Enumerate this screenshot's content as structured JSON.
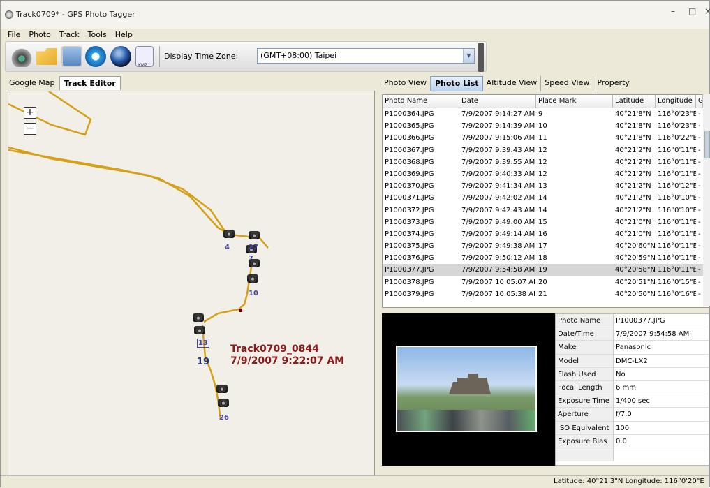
{
  "window": {
    "title": "Track0709* - GPS Photo Tagger"
  },
  "menu": [
    {
      "u": "F",
      "rest": "ile"
    },
    {
      "u": "P",
      "rest": "hoto"
    },
    {
      "u": "T",
      "rest": "rack"
    },
    {
      "u": "T",
      "rest": "ools"
    },
    {
      "u": "H",
      "rest": "elp"
    }
  ],
  "toolbar": {
    "kmz_label": "KMZ",
    "timezone_label": "Display Time Zone:",
    "timezone_value": "(GMT+08:00) Taipei"
  },
  "left_tabs": [
    "Google Map",
    "Track Editor"
  ],
  "map": {
    "track_name": "Track0709_0844",
    "track_time": "7/9/2007 9:22:07 AM",
    "zoom_in": "+",
    "zoom_out": "−",
    "markers": [
      "4",
      "27",
      "7",
      "10",
      "13",
      "19",
      "26"
    ]
  },
  "right_tabs": [
    "Photo View",
    "Photo List",
    "Altitude View",
    "Speed View",
    "Property"
  ],
  "grid": {
    "columns": [
      "Photo Name",
      "Date",
      "Place Mark",
      "Latitude",
      "Longitude",
      "G"
    ],
    "rows": [
      [
        "P1000364.JPG",
        "7/9/2007 9:14:27 AM",
        "9",
        "40°21'8\"N",
        "116°0'23\"E",
        "-"
      ],
      [
        "P1000365.JPG",
        "7/9/2007 9:14:39 AM",
        "10",
        "40°21'8\"N",
        "116°0'23\"E",
        "-"
      ],
      [
        "P1000366.JPG",
        "7/9/2007 9:15:06 AM",
        "11",
        "40°21'8\"N",
        "116°0'22\"E",
        "-"
      ],
      [
        "P1000367.JPG",
        "7/9/2007 9:39:43 AM",
        "12",
        "40°21'2\"N",
        "116°0'11\"E",
        "-"
      ],
      [
        "P1000368.JPG",
        "7/9/2007 9:39:55 AM",
        "12",
        "40°21'2\"N",
        "116°0'11\"E",
        "-"
      ],
      [
        "P1000369.JPG",
        "7/9/2007 9:40:33 AM",
        "12",
        "40°21'2\"N",
        "116°0'11\"E",
        "-"
      ],
      [
        "P1000370.JPG",
        "7/9/2007 9:41:34 AM",
        "13",
        "40°21'2\"N",
        "116°0'12\"E",
        "-"
      ],
      [
        "P1000371.JPG",
        "7/9/2007 9:42:02 AM",
        "14",
        "40°21'2\"N",
        "116°0'10\"E",
        "-"
      ],
      [
        "P1000372.JPG",
        "7/9/2007 9:42:43 AM",
        "14",
        "40°21'2\"N",
        "116°0'10\"E",
        "-"
      ],
      [
        "P1000373.JPG",
        "7/9/2007 9:49:00 AM",
        "15",
        "40°21'0\"N",
        "116°0'11\"E",
        "-"
      ],
      [
        "P1000374.JPG",
        "7/9/2007 9:49:14 AM",
        "16",
        "40°21'0\"N",
        "116°0'11\"E",
        "-"
      ],
      [
        "P1000375.JPG",
        "7/9/2007 9:49:38 AM",
        "17",
        "40°20'60\"N",
        "116°0'11\"E",
        "-"
      ],
      [
        "P1000376.JPG",
        "7/9/2007 9:50:12 AM",
        "18",
        "40°20'59\"N",
        "116°0'11\"E",
        "-"
      ],
      [
        "P1000377.JPG",
        "7/9/2007 9:54:58 AM",
        "19",
        "40°20'58\"N",
        "116°0'11\"E",
        "-"
      ],
      [
        "P1000378.JPG",
        "7/9/2007 10:05:07 AI",
        "20",
        "40°20'51\"N",
        "116°0'15\"E",
        "-"
      ],
      [
        "P1000379.JPG",
        "7/9/2007 10:05:38 AI",
        "21",
        "40°20'50\"N",
        "116°0'16\"E",
        "-"
      ]
    ]
  },
  "exif": [
    [
      "Photo Name",
      "P1000377.JPG"
    ],
    [
      "Date/Time",
      "7/9/2007 9:54:58 AM"
    ],
    [
      "Make",
      "Panasonic"
    ],
    [
      "Model",
      "DMC-LX2"
    ],
    [
      "Flash Used",
      "No"
    ],
    [
      "Focal Length",
      "6 mm"
    ],
    [
      "Exposure Time",
      "1/400 sec"
    ],
    [
      "Aperture",
      "f/7.0"
    ],
    [
      "ISO Equivalent",
      "100"
    ],
    [
      "Exposure Bias",
      "0.0"
    ],
    [
      "",
      ""
    ]
  ],
  "status": {
    "text": "Latitude: 40°21'3\"N  Longitude: 116°0'20\"E"
  }
}
